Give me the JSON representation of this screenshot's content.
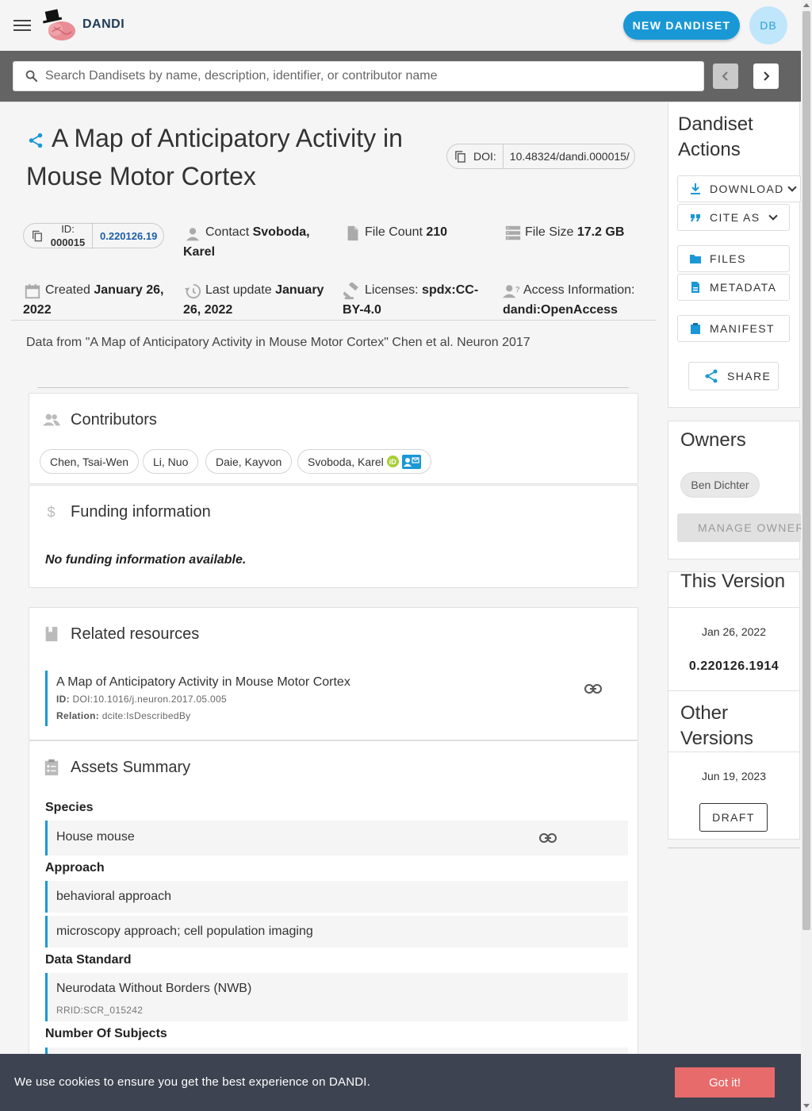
{
  "app": {
    "brand": "DANDI",
    "new_dandiset_label": "NEW DANDISET",
    "user_initials": "DB"
  },
  "search": {
    "placeholder": "Search Dandisets by name, description, identifier, or contributor name"
  },
  "dandiset": {
    "title": "A Map of Anticipatory Activity in Mouse Motor Cortex",
    "doi_label": "DOI:",
    "doi_value": "10.48324/dandi.000015/",
    "id_label": "ID:",
    "id_value": "000015",
    "version": "0.220126.19",
    "contact_label": "Contact",
    "contact_value": "Svoboda, Karel",
    "file_count_label": "File Count",
    "file_count_value": "210",
    "file_size_label": "File Size",
    "file_size_value": "17.2 GB",
    "created_label": "Created",
    "created_value": "January 26, 2022",
    "updated_label": "Last update",
    "updated_value": "January 26, 2022",
    "licenses_label": "Licenses:",
    "licenses_value": "spdx:CC-BY-4.0",
    "access_label": "Access Information:",
    "access_value": "dandi:OpenAccess",
    "description": "Data from \"A Map of Anticipatory Activity in Mouse Motor Cortex\" Chen et al. Neuron 2017"
  },
  "contributors": {
    "title": "Contributors",
    "items": [
      "Chen, Tsai-Wen",
      "Li, Nuo",
      "Daie, Kayvon",
      "Svoboda, Karel"
    ],
    "orcid_badge": "iD"
  },
  "funding": {
    "title": "Funding information",
    "empty_text": "No funding information available."
  },
  "related": {
    "title": "Related resources",
    "items": [
      {
        "title": "A Map of Anticipatory Activity in Mouse Motor Cortex",
        "id_label": "ID:",
        "id_value": "DOI:10.1016/j.neuron.2017.05.005",
        "relation_label": "Relation:",
        "relation_value": "dcite:IsDescribedBy"
      }
    ]
  },
  "assets": {
    "title": "Assets Summary",
    "species_label": "Species",
    "species": [
      "House mouse"
    ],
    "approach_label": "Approach",
    "approach": [
      "behavioral approach",
      "microscopy approach; cell population imaging"
    ],
    "standard_label": "Data Standard",
    "standard": [
      {
        "name": "Neurodata Without Borders (NWB)",
        "rrid": "RRID:SCR_015242"
      }
    ],
    "subjects_label": "Number Of Subjects"
  },
  "sidebar": {
    "actions_title": "Dandiset Actions",
    "download_label": "DOWNLOAD",
    "cite_label": "CITE AS",
    "files_label": "FILES",
    "metadata_label": "METADATA",
    "manifest_label": "MANIFEST",
    "share_label": "SHARE",
    "owners_title": "Owners",
    "owners": [
      "Ben Dichter"
    ],
    "manage_label": "MANAGE OWNERS",
    "this_version_title": "This Version",
    "this_version_date": "Jan 26, 2022",
    "this_version_number": "0.220126.1914",
    "other_versions_title": "Other Versions",
    "other_version_date": "Jun 19, 2023",
    "other_version_label": "DRAFT"
  },
  "cookie": {
    "text": "We use cookies to ensure you get the best experience on DANDI.",
    "button": "Got it!"
  },
  "colors": {
    "accent": "#1a98d6",
    "link": "#1d5fa6",
    "cookie_bg": "#3d4350",
    "cookie_button": "#e76b6b",
    "searchbar_bg": "#646464"
  }
}
